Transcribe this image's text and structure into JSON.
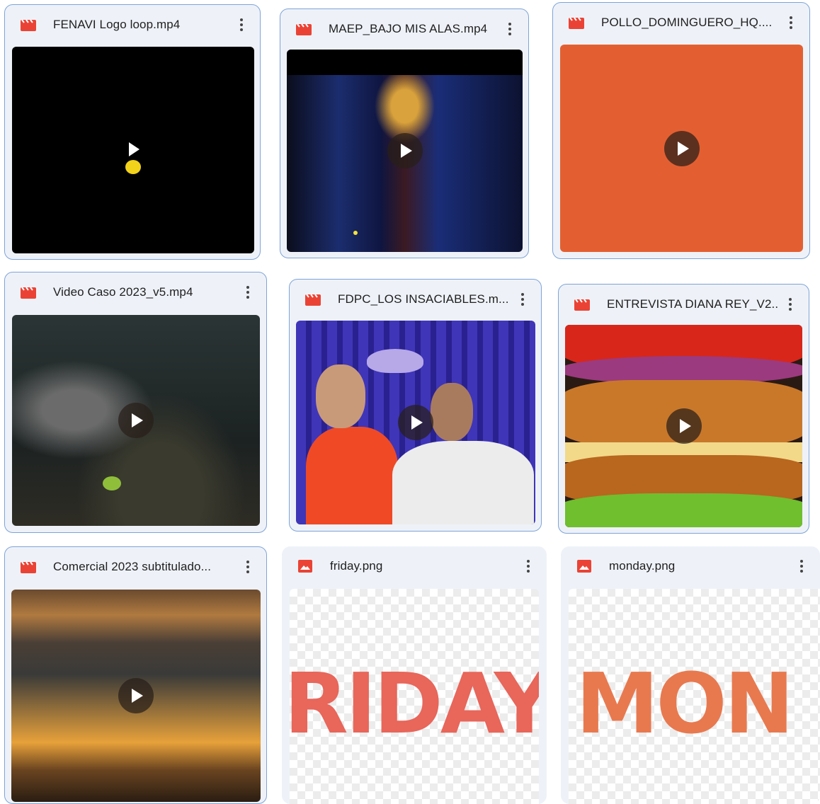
{
  "files": [
    {
      "name": "FENAVI Logo loop.mp4",
      "type": "video"
    },
    {
      "name": "MAEP_BAJO MIS ALAS.mp4",
      "type": "video"
    },
    {
      "name": "POLLO_DOMINGUERO_HQ....",
      "type": "video"
    },
    {
      "name": "Video Caso 2023_v5.mp4",
      "type": "video"
    },
    {
      "name": "FDPC_LOS INSACIABLES.m...",
      "type": "video"
    },
    {
      "name": "ENTREVISTA DIANA REY_V2...",
      "type": "video"
    },
    {
      "name": "Comercial 2023 subtitulado...",
      "type": "video"
    },
    {
      "name": "friday.png",
      "type": "image",
      "overlay": "RIDAY"
    },
    {
      "name": "monday.png",
      "type": "image",
      "overlay": "MON"
    }
  ],
  "icons": {
    "video": "video-file-icon",
    "image": "image-file-icon",
    "more": "more-vert-icon",
    "play": "play-icon"
  },
  "colors": {
    "file_icon": "#ea4335",
    "selected_border": "#7ea3d8",
    "card_bg": "#eef2f8",
    "accent_orange": "#e35f31",
    "overlay_text": "#e8665a"
  }
}
